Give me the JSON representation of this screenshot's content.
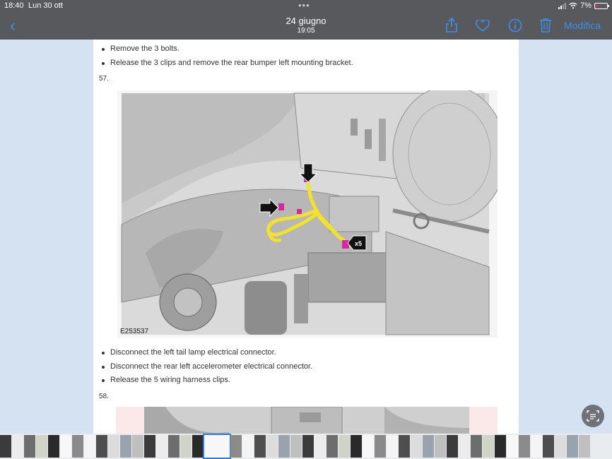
{
  "status_bar": {
    "time": "18:40",
    "date": "Lun 30 ott",
    "battery": "7%"
  },
  "nav": {
    "title": "24 giugno",
    "subtitle": "19:05",
    "edit_label": "Modifica"
  },
  "document": {
    "bullets_top": [
      "Remove the 3 bolts.",
      "Release the 3 clips and remove the rear bumper left mounting bracket."
    ],
    "step_57": "57.",
    "figure_id": "E253537",
    "clip_callout": "x5",
    "bullets_bottom": [
      "Disconnect the left tail lamp electrical connector.",
      "Disconnect the rear left accelerometer electrical connector.",
      "Release the 5 wiring harness clips."
    ],
    "step_58": "58."
  },
  "colors": {
    "accent": "#3a8ff0",
    "bar_bg": "#57595c",
    "harness": "#f2e22a",
    "connector": "#d02a9f"
  },
  "thumbnails": {
    "count": 48,
    "selected_index": 17
  }
}
